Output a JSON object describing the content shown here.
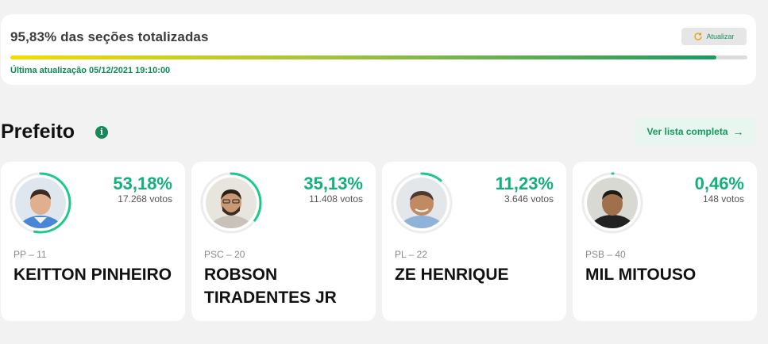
{
  "status": {
    "title": "95,83% das seções totalizadas",
    "progress": 0.9583,
    "refresh_label": "Atualizar",
    "last_update": "Última atualização 05/12/2021 19:10:00"
  },
  "section": {
    "title": "Prefeito",
    "info_icon": "i",
    "list_button_label": "Ver lista completa",
    "list_button_arrow": "→"
  },
  "colors": {
    "accent": "#14b07a",
    "ring": "#1ec78a",
    "ring_track": "#ececec"
  },
  "candidates": [
    {
      "percent": "53,18%",
      "percent_value": 53.18,
      "votes": "17.268 votos",
      "party": "PP – 11",
      "name": "KEITTON PINHEIRO"
    },
    {
      "percent": "35,13%",
      "percent_value": 35.13,
      "votes": "11.408 votos",
      "party": "PSC – 20",
      "name": "ROBSON TIRADENTES JR"
    },
    {
      "percent": "11,23%",
      "percent_value": 11.23,
      "votes": "3.646 votos",
      "party": "PL – 22",
      "name": "ZE HENRIQUE"
    },
    {
      "percent": "0,46%",
      "percent_value": 0.46,
      "votes": "148 votos",
      "party": "PSB – 40",
      "name": "MIL MITOUSO"
    }
  ]
}
